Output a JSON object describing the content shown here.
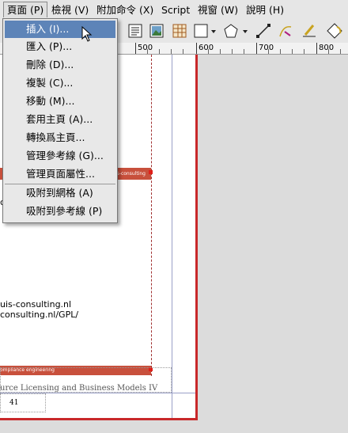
{
  "menubar": {
    "items": [
      "頁面 (P)",
      "檢視 (V)",
      "附加命令 (X)",
      "Script",
      "視窗 (W)",
      "說明 (H)"
    ]
  },
  "toolbar": {
    "icons": [
      "text-frame-icon",
      "image-frame-icon",
      "table-icon",
      "rectangle-icon",
      "polygon-icon",
      "line-icon",
      "bezier-icon",
      "freehand-icon",
      "rotate-icon"
    ]
  },
  "ruler": {
    "labels": [
      "500",
      "600",
      "700",
      "800"
    ]
  },
  "page_menu": {
    "items": [
      "插入 (I)...",
      "匯入 (P)...",
      "刪除 (D)...",
      "複製 (C)...",
      "移動 (M)...",
      "套用主頁 (A)...",
      "轉換爲主頁...",
      "管理參考線 (G)...",
      "管理頁面屬性...",
      "吸附到網格 (A)",
      "吸附到參考線 (P)"
    ]
  },
  "document": {
    "band_top_text": "is-consulting",
    "letter_c": "c",
    "url_1": "uis-consulting.nl",
    "url_2": "consulting.nl/GPL/",
    "band_bottom_text": "ompliance engineering",
    "footer_title": "urce Licensing and Business Models IV",
    "page_number": "41"
  },
  "colors": {
    "highlight": "#5d84b8",
    "page_border": "#c8282a",
    "band": "#c8503c"
  }
}
